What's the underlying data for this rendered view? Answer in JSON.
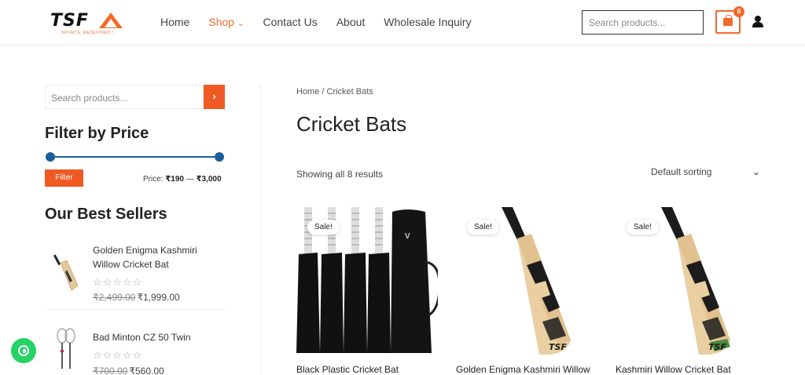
{
  "header": {
    "logo": {
      "text": "TSF",
      "tagline": "SPORTS, REDEFINED !"
    },
    "nav": [
      {
        "label": "Home",
        "active": false
      },
      {
        "label": "Shop",
        "active": true,
        "has_dropdown": true
      },
      {
        "label": "Contact Us",
        "active": false
      },
      {
        "label": "About",
        "active": false
      },
      {
        "label": "Wholesale Inquiry",
        "active": false
      }
    ],
    "search_placeholder": "Search products...",
    "cart_count": "0",
    "icons": {
      "cart": "shopping-bag-icon",
      "user": "user-icon",
      "chevron": "chevron-down-icon"
    },
    "accent_color": "#ef6b2c"
  },
  "sidebar": {
    "search_placeholder": "Search products...",
    "search_button_icon": "chevron-right-icon",
    "filter_title": "Filter by Price",
    "filter_button": "Filter",
    "price_label": "Price:",
    "price_min": "₹190",
    "price_separator": "—",
    "price_max": "₹3,000",
    "slider_color": "#1a5f9a",
    "best_sellers_title": "Our Best Sellers",
    "best_sellers": [
      {
        "name": "Golden Enigma Kashmiri Willow Cricket Bat",
        "rating": "☆☆☆☆☆",
        "old_price": "₹2,499.00",
        "price": "₹1,999.00"
      },
      {
        "name": "Bad Minton CZ 50 Twin",
        "rating": "☆☆☆☆☆",
        "old_price": "₹700.00",
        "price": "₹560.00"
      }
    ]
  },
  "main": {
    "breadcrumb": "Home / Cricket Bats",
    "title": "Cricket Bats",
    "result_count": "Showing all 8 results",
    "sorting": "Default sorting",
    "products": [
      {
        "name": "Black Plastic Cricket Bat",
        "badge": "Sale!"
      },
      {
        "name": "Golden Enigma Kashmiri Willow",
        "badge": "Sale!"
      },
      {
        "name": "Kashmiri Willow Cricket Bat",
        "badge": "Sale!"
      }
    ]
  },
  "floating": {
    "whatsapp_icon": "whatsapp-icon",
    "whatsapp_color": "#25d366"
  }
}
